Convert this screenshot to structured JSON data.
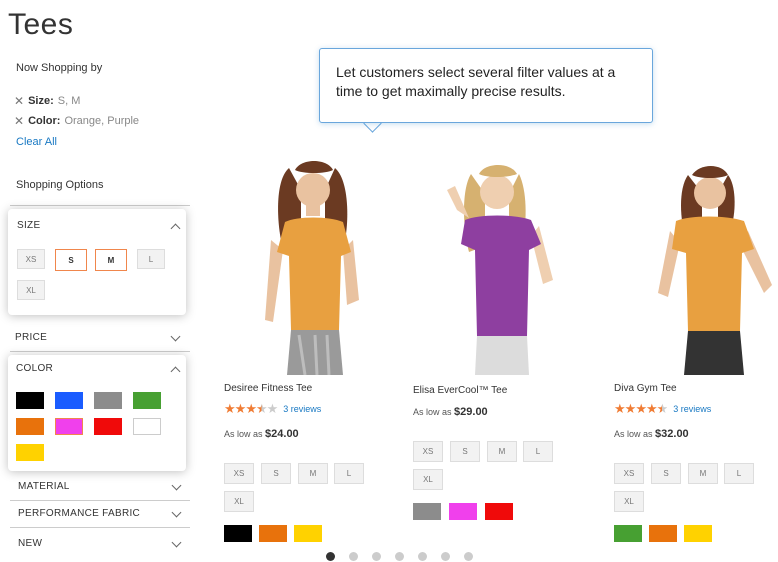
{
  "page_title": "Tees",
  "now_shopping_label": "Now Shopping by",
  "active_filters": [
    {
      "label": "Size:",
      "values": "S, M"
    },
    {
      "label": "Color:",
      "values": "Orange, Purple"
    }
  ],
  "clear_all_label": "Clear All",
  "shopping_options_label": "Shopping Options",
  "size_filter": {
    "title": "SIZE",
    "options": [
      "XS",
      "S",
      "M",
      "L",
      "XL"
    ]
  },
  "price_label": "PRICE",
  "color_filter": {
    "title": "COLOR",
    "swatches": [
      "#000000",
      "#1a5cff",
      "#8c8c8c",
      "#47a032",
      "#e8720c",
      "#f040ec",
      "#f00a0a",
      "#ffffff",
      "#ffd200"
    ]
  },
  "collapsed_filters": [
    "MATERIAL",
    "PERFORMANCE FABRIC",
    "NEW"
  ],
  "tooltip_text": "Let customers select several filter values at a time to get maximally precise results.",
  "products": [
    {
      "name": "Desiree Fitness Tee",
      "rating": 3.5,
      "reviews": "3 reviews",
      "price_prefix": "As low as",
      "price": "$24.00",
      "shirt_color": "#e8a040",
      "hair_color": "#6b3a22",
      "sizes": [
        "XS",
        "S",
        "M",
        "L",
        "XL"
      ],
      "colors": [
        "#000000",
        "#e8720c",
        "#ffd200"
      ]
    },
    {
      "name": "Elisa EverCool™ Tee",
      "price_prefix": "As low as",
      "price": "$29.00",
      "shirt_color": "#8e3fa0",
      "hair_color": "#d6b170",
      "sizes": [
        "XS",
        "S",
        "M",
        "L",
        "XL"
      ],
      "colors": [
        "#8c8c8c",
        "#f040ec",
        "#f00a0a"
      ]
    },
    {
      "name": "Diva Gym Tee",
      "rating": 4.5,
      "reviews": "3 reviews",
      "price_prefix": "As low as",
      "price": "$32.00",
      "shirt_color": "#e8a040",
      "hair_color": "#6b3a22",
      "sizes": [
        "XS",
        "S",
        "M",
        "L",
        "XL"
      ],
      "colors": [
        "#47a032",
        "#e8720c",
        "#ffd200"
      ]
    }
  ],
  "carousel": {
    "count": 7,
    "active": 0
  }
}
